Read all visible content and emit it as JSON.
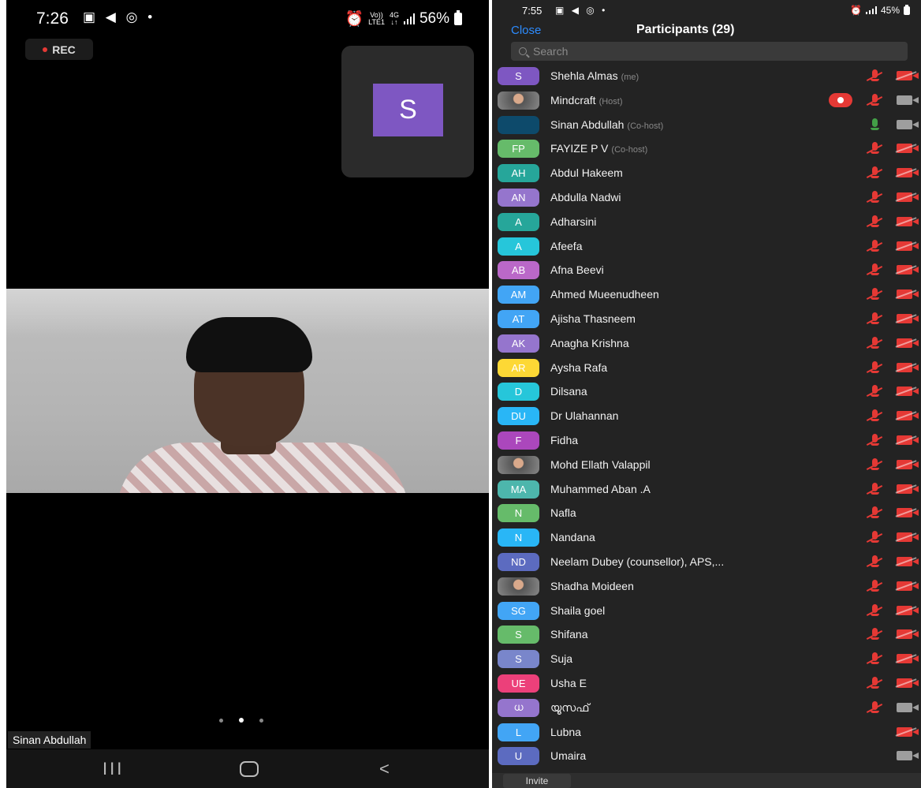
{
  "left_screen": {
    "status_bar": {
      "time": "7:26",
      "network_top": "Vo))",
      "network_bottom": "LTE1",
      "network_gen": "4G",
      "battery": "56%"
    },
    "rec_badge": "REC",
    "thumbnail_initial": "S",
    "speaker_name": "Sinan Abdullah",
    "nav": {
      "recent": "III",
      "back": "<"
    }
  },
  "right_screen": {
    "status_bar": {
      "time": "7:55",
      "battery": "45%"
    },
    "header": {
      "close": "Close",
      "title": "Participants (29)"
    },
    "search": {
      "placeholder": "Search"
    },
    "participants": [
      {
        "initials": "S",
        "name": "Shehla Almas",
        "role": "(me)",
        "color": "#7e57c2",
        "mic": "muted",
        "cam": "off"
      },
      {
        "initials": "",
        "photo": true,
        "name": "Mindcraft",
        "role": "(Host)",
        "color": "#666666",
        "mic": "muted",
        "cam": "on",
        "recording": true
      },
      {
        "initials": "",
        "name": "Sinan Abdullah",
        "role": "(Co-host)",
        "color": "#0d4a6b",
        "mic": "on",
        "cam": "on"
      },
      {
        "initials": "FP",
        "name": "FAYIZE P V",
        "role": "(Co-host)",
        "color": "#66bb6a",
        "mic": "muted",
        "cam": "off"
      },
      {
        "initials": "AH",
        "name": "Abdul Hakeem",
        "role": "",
        "color": "#26a69a",
        "mic": "muted",
        "cam": "off"
      },
      {
        "initials": "AN",
        "name": "Abdulla Nadwi",
        "role": "",
        "color": "#9575cd",
        "mic": "muted",
        "cam": "off"
      },
      {
        "initials": "A",
        "name": "Adharsini",
        "role": "",
        "color": "#26a69a",
        "mic": "muted",
        "cam": "off"
      },
      {
        "initials": "A",
        "name": "Afeefa",
        "role": "",
        "color": "#26c6da",
        "mic": "muted",
        "cam": "off"
      },
      {
        "initials": "AB",
        "name": "Afna Beevi",
        "role": "",
        "color": "#ba68c8",
        "mic": "muted",
        "cam": "off"
      },
      {
        "initials": "AM",
        "name": "Ahmed Mueenudheen",
        "role": "",
        "color": "#42a5f5",
        "mic": "muted",
        "cam": "off"
      },
      {
        "initials": "AT",
        "name": "Ajisha Thasneem",
        "role": "",
        "color": "#42a5f5",
        "mic": "muted",
        "cam": "off"
      },
      {
        "initials": "AK",
        "name": "Anagha Krishna",
        "role": "",
        "color": "#9575cd",
        "mic": "muted",
        "cam": "off"
      },
      {
        "initials": "AR",
        "name": "Aysha Rafa",
        "role": "",
        "color": "#fdd835",
        "mic": "muted",
        "cam": "off"
      },
      {
        "initials": "D",
        "name": "Dilsana",
        "role": "",
        "color": "#26c6da",
        "mic": "muted",
        "cam": "off"
      },
      {
        "initials": "DU",
        "name": "Dr Ulahannan",
        "role": "",
        "color": "#29b6f6",
        "mic": "muted",
        "cam": "off"
      },
      {
        "initials": "F",
        "name": "Fidha",
        "role": "",
        "color": "#ab47bc",
        "mic": "muted",
        "cam": "off"
      },
      {
        "initials": "",
        "photo": true,
        "name": "Mohd Ellath Valappil",
        "role": "",
        "color": "#666666",
        "mic": "muted",
        "cam": "off"
      },
      {
        "initials": "MA",
        "name": "Muhammed Aban .A",
        "role": "",
        "color": "#4db6ac",
        "mic": "muted",
        "cam": "off"
      },
      {
        "initials": "N",
        "name": "Nafla",
        "role": "",
        "color": "#66bb6a",
        "mic": "muted",
        "cam": "off"
      },
      {
        "initials": "N",
        "name": "Nandana",
        "role": "",
        "color": "#29b6f6",
        "mic": "muted",
        "cam": "off"
      },
      {
        "initials": "ND",
        "name": "Neelam Dubey (counsellor),  APS,...",
        "role": "",
        "color": "#5c6bc0",
        "mic": "muted",
        "cam": "off"
      },
      {
        "initials": "",
        "photo": true,
        "name": "Shadha Moideen",
        "role": "",
        "color": "#8d6e63",
        "mic": "muted",
        "cam": "off"
      },
      {
        "initials": "SG",
        "name": "Shaila goel",
        "role": "",
        "color": "#42a5f5",
        "mic": "muted",
        "cam": "off"
      },
      {
        "initials": "S",
        "name": "Shifana",
        "role": "",
        "color": "#66bb6a",
        "mic": "muted",
        "cam": "off"
      },
      {
        "initials": "S",
        "name": "Suja",
        "role": "",
        "color": "#7986cb",
        "mic": "muted",
        "cam": "off"
      },
      {
        "initials": "UE",
        "name": "Usha E",
        "role": "",
        "color": "#ec407a",
        "mic": "muted",
        "cam": "off"
      },
      {
        "initials": "ധ",
        "name": "യൂസഫ്",
        "role": "",
        "color": "#9575cd",
        "mic": "muted",
        "cam": "on"
      },
      {
        "initials": "L",
        "name": "Lubna",
        "role": "",
        "color": "#42a5f5",
        "mic": "none",
        "cam": "off"
      },
      {
        "initials": "U",
        "name": "Umaira",
        "role": "",
        "color": "#5c6bc0",
        "mic": "none",
        "cam": "on"
      }
    ],
    "invite": "Invite"
  }
}
